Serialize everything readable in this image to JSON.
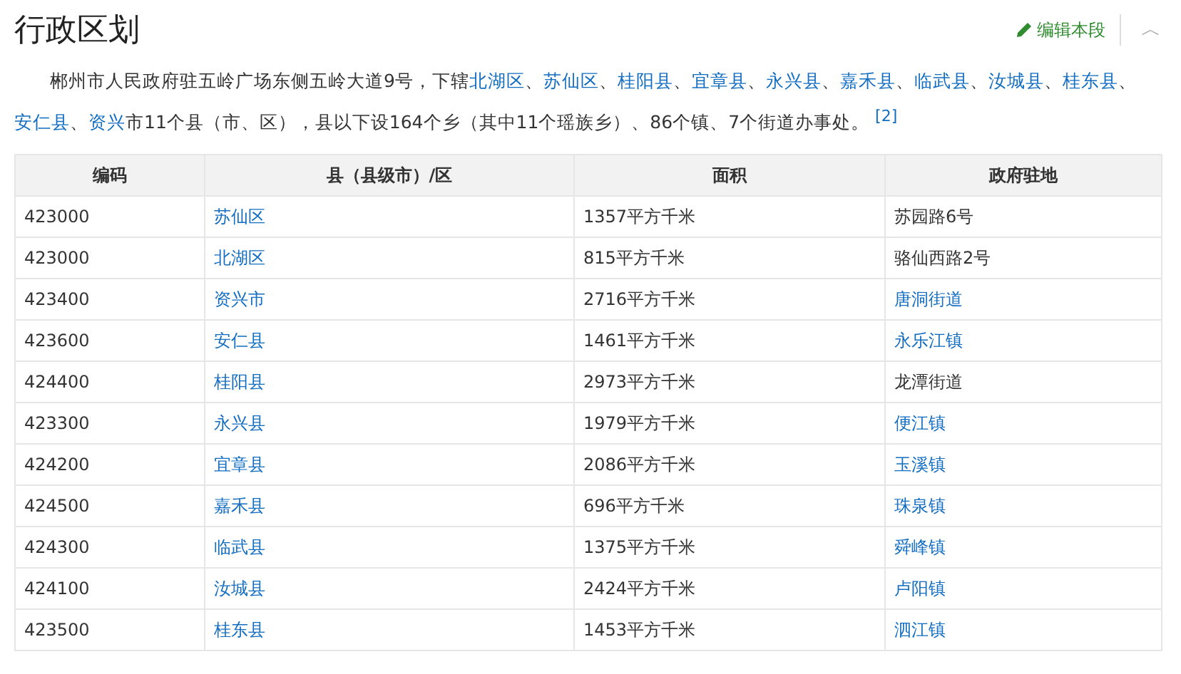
{
  "section": {
    "title": "行政区划",
    "edit_label": "编辑本段",
    "collapse_icon": "︿"
  },
  "paragraph": {
    "segments": [
      {
        "text": "郴州市人民政府驻五岭广场东侧五岭大道9号，下辖",
        "link": false
      },
      {
        "text": "北湖区",
        "link": true
      },
      {
        "text": "、",
        "link": false
      },
      {
        "text": "苏仙区",
        "link": true
      },
      {
        "text": "、",
        "link": false
      },
      {
        "text": "桂阳县",
        "link": true
      },
      {
        "text": "、",
        "link": false
      },
      {
        "text": "宜章县",
        "link": true
      },
      {
        "text": "、",
        "link": false
      },
      {
        "text": "永兴县",
        "link": true
      },
      {
        "text": "、",
        "link": false
      },
      {
        "text": "嘉禾县",
        "link": true
      },
      {
        "text": "、",
        "link": false
      },
      {
        "text": "临武县",
        "link": true
      },
      {
        "text": "、",
        "link": false
      },
      {
        "text": "汝城县",
        "link": true
      },
      {
        "text": "、",
        "link": false
      },
      {
        "text": "桂东县",
        "link": true
      },
      {
        "text": "、",
        "link": false
      },
      {
        "text": "安仁县",
        "link": true
      },
      {
        "text": "、",
        "link": false
      },
      {
        "text": "资兴",
        "link": true
      },
      {
        "text": "市11个县（市、区），县以下设164个乡（其中11个瑶族乡）、86个镇、7个街道办事处。",
        "link": false
      }
    ],
    "footnote": "[2]"
  },
  "table": {
    "columns": [
      "编码",
      "县（县级市）/区",
      "面积",
      "政府驻地"
    ],
    "rows": [
      {
        "code": "423000",
        "county": "苏仙区",
        "area": "1357平方千米",
        "seat": "苏园路6号",
        "seat_link": false
      },
      {
        "code": "423000",
        "county": "北湖区",
        "area": "815平方千米",
        "seat": "骆仙西路2号",
        "seat_link": false
      },
      {
        "code": "423400",
        "county": "资兴市",
        "area": "2716平方千米",
        "seat": "唐洞街道",
        "seat_link": true
      },
      {
        "code": "423600",
        "county": "安仁县",
        "area": "1461平方千米",
        "seat": "永乐江镇",
        "seat_link": true
      },
      {
        "code": "424400",
        "county": "桂阳县",
        "area": "2973平方千米",
        "seat": "龙潭街道",
        "seat_link": false
      },
      {
        "code": "423300",
        "county": "永兴县",
        "area": "1979平方千米",
        "seat": "便江镇",
        "seat_link": true
      },
      {
        "code": "424200",
        "county": "宜章县",
        "area": "2086平方千米",
        "seat": "玉溪镇",
        "seat_link": true
      },
      {
        "code": "424500",
        "county": "嘉禾县",
        "area": "696平方千米",
        "seat": "珠泉镇",
        "seat_link": true
      },
      {
        "code": "424300",
        "county": "临武县",
        "area": "1375平方千米",
        "seat": "舜峰镇",
        "seat_link": true
      },
      {
        "code": "424100",
        "county": "汝城县",
        "area": "2424平方千米",
        "seat": "卢阳镇",
        "seat_link": true
      },
      {
        "code": "423500",
        "county": "桂东县",
        "area": "1453平方千米",
        "seat": "泗江镇",
        "seat_link": true
      }
    ]
  }
}
